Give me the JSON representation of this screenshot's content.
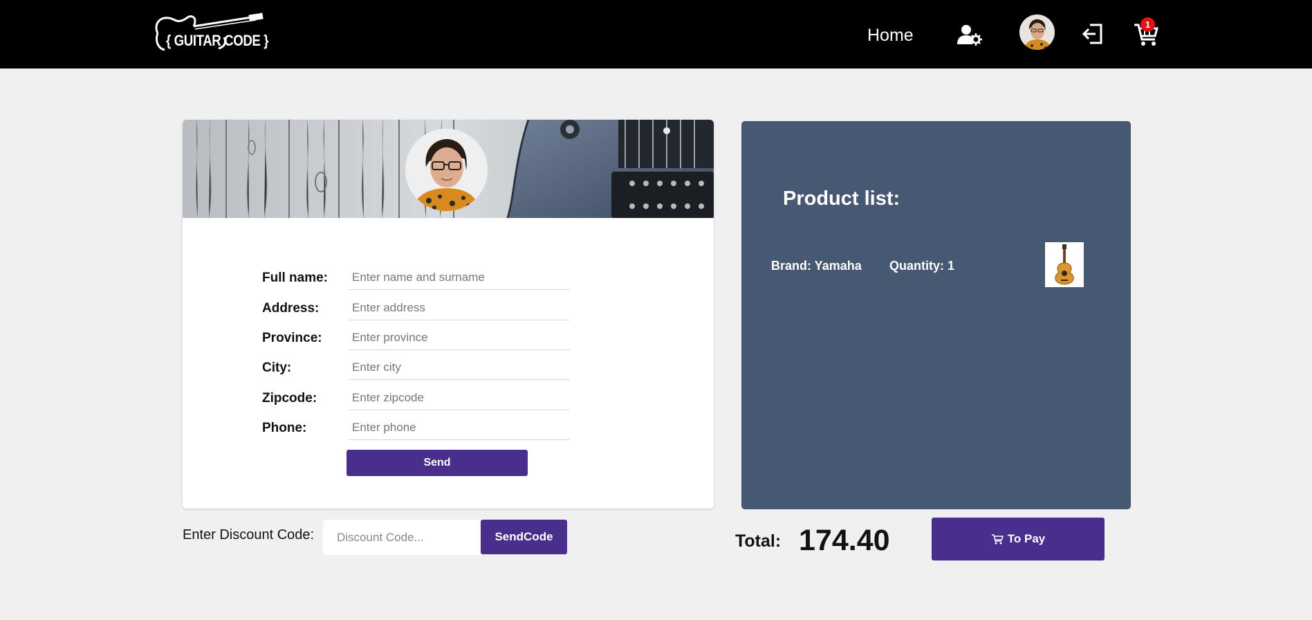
{
  "navbar": {
    "logo_text": "{ GUITAR CODE }",
    "home_label": "Home",
    "cart_count": "1",
    "icons": [
      "user-settings-icon",
      "avatar",
      "logout-icon",
      "cart-icon"
    ]
  },
  "profile_form": {
    "fields": [
      {
        "label": "Full name:",
        "placeholder": "Enter name and surname"
      },
      {
        "label": "Address:",
        "placeholder": "Enter address"
      },
      {
        "label": "Province:",
        "placeholder": "Enter province"
      },
      {
        "label": "City:",
        "placeholder": "Enter city"
      },
      {
        "label": "Zipcode:",
        "placeholder": "Enter zipcode"
      },
      {
        "label": "Phone:",
        "placeholder": "Enter phone"
      }
    ],
    "send_label": "Send"
  },
  "product_list": {
    "title": "Product list:",
    "items": [
      {
        "brand": "Brand: Yamaha",
        "quantity": "Quantity: 1"
      }
    ]
  },
  "discount": {
    "label": "Enter Discount Code:",
    "placeholder": "Discount Code...",
    "button_label": "SendCode"
  },
  "checkout": {
    "total_label": "Total:",
    "total_value": "174.40",
    "pay_label": "To Pay"
  },
  "colors": {
    "nav_bg": "#000000",
    "page_bg": "#f0f0f0",
    "accent": "#4a2e8c",
    "product_card_bg": "#475872",
    "badge": "#e01414"
  }
}
